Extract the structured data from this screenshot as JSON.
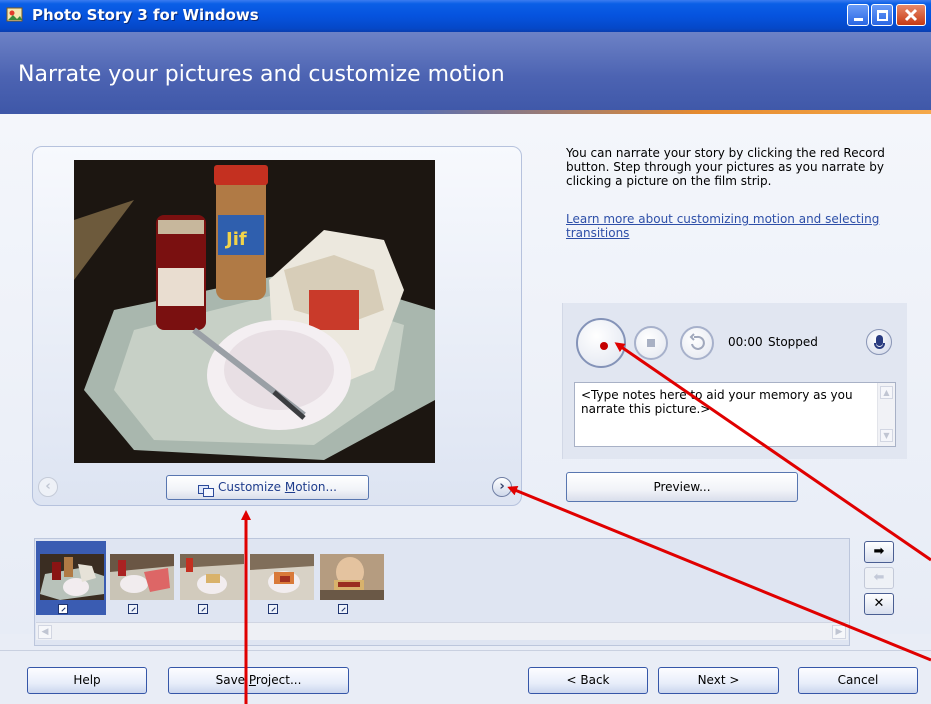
{
  "window": {
    "title": "Photo Story 3 for Windows"
  },
  "header": {
    "title": "Narrate your pictures and customize motion"
  },
  "preview": {
    "customize_label_pre": "Customize ",
    "customize_label_u": "M",
    "customize_label_post": "otion..."
  },
  "instructions": {
    "text": "You can narrate your story by clicking the red Record button. Step through your pictures as you narrate by clicking a picture on the film strip.",
    "link": "Learn more about customizing motion and selecting transitions"
  },
  "recorder": {
    "time": "00:00",
    "status": "Stopped",
    "notes_placeholder": "<Type notes here to aid your memory as you narrate this picture.>"
  },
  "preview_button": "Preview...",
  "filmstrip": {
    "thumbnails": [
      {
        "selected": true
      },
      {
        "selected": false
      },
      {
        "selected": false
      },
      {
        "selected": false
      },
      {
        "selected": false
      }
    ],
    "move_right_icon": "arrow-right-icon",
    "move_left_icon": "arrow-left-icon",
    "remove_icon": "delete-x-icon"
  },
  "footer": {
    "help": "Help",
    "save_pre": "Save ",
    "save_u": "P",
    "save_post": "roject...",
    "back": "< Back",
    "next": "Next >",
    "cancel": "Cancel"
  },
  "colors": {
    "titlebar": "#0653de",
    "header": "#4c63b2",
    "accent": "#e58a2f",
    "annotation_arrow": "#e00000"
  }
}
